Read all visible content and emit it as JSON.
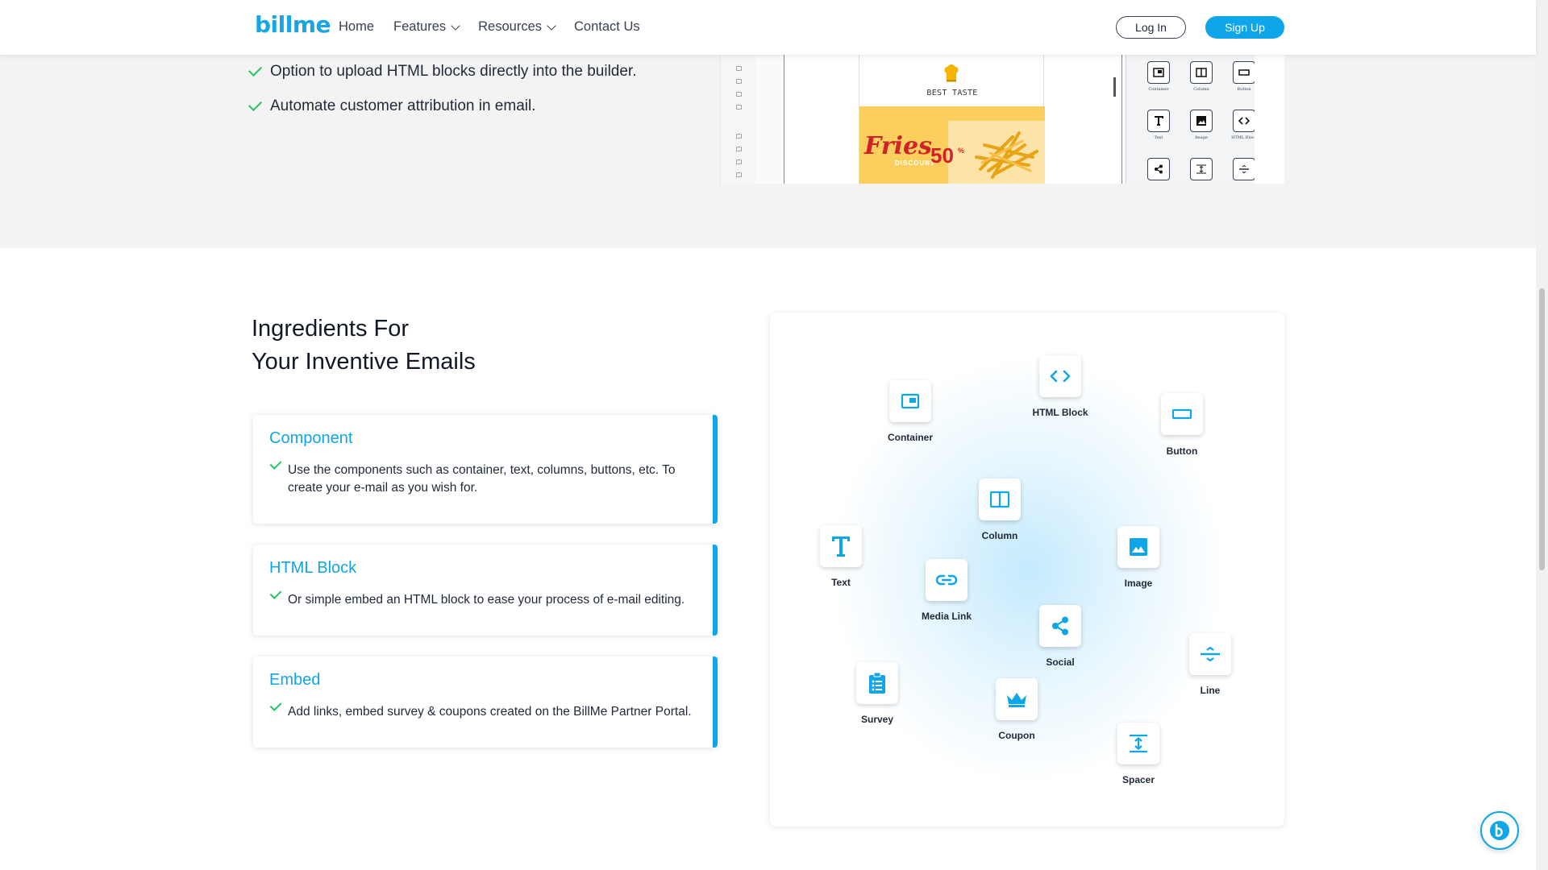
{
  "nav": {
    "logo": "billme",
    "links": [
      "Home",
      "Features",
      "Resources",
      "Contact Us"
    ],
    "login": "Log In",
    "signup": "Sign Up"
  },
  "top_features": [
    "Option to upload HTML blocks directly into the builder.",
    "Automate customer attribution in email."
  ],
  "builder_preview": {
    "tagline": "BEST TASTE",
    "banner_word": "Fries",
    "banner_sub": "DISCOUNT",
    "banner_value": "50",
    "banner_pct": "%",
    "panel_items": [
      "Container",
      "Column",
      "Button",
      "Text",
      "Image",
      "HTML Block"
    ]
  },
  "ingredients": {
    "heading_line1": "Ingredients For",
    "heading_line2": "Your Inventive Emails",
    "cards": [
      {
        "title": "Component",
        "text": "Use the components such as container, text, columns, buttons, etc. To create your e-mail as you wish for."
      },
      {
        "title": "HTML Block",
        "text": "Or simple embed an HTML block to ease your process of e-mail editing."
      },
      {
        "title": "Embed",
        "text": "Add links, embed survey & coupons created on the BillMe Partner Portal."
      }
    ]
  },
  "diagram_nodes": [
    {
      "name": "container",
      "label": "Container",
      "icon": "container-icon"
    },
    {
      "name": "html-block",
      "label": "HTML Block",
      "icon": "code-icon"
    },
    {
      "name": "button",
      "label": "Button",
      "icon": "button-icon"
    },
    {
      "name": "column",
      "label": "Column",
      "icon": "column-icon"
    },
    {
      "name": "text",
      "label": "Text",
      "icon": "text-icon"
    },
    {
      "name": "image",
      "label": "Image",
      "icon": "image-icon"
    },
    {
      "name": "media-link",
      "label": "Media Link",
      "icon": "link-icon"
    },
    {
      "name": "social",
      "label": "Social",
      "icon": "share-icon"
    },
    {
      "name": "line",
      "label": "Line",
      "icon": "divider-icon"
    },
    {
      "name": "survey",
      "label": "Survey",
      "icon": "clipboard-icon"
    },
    {
      "name": "coupon",
      "label": "Coupon",
      "icon": "crown-icon"
    },
    {
      "name": "spacer",
      "label": "Spacer",
      "icon": "spacer-icon"
    }
  ],
  "colors": {
    "accent": "#0ea5e9",
    "check": "#22c55e"
  }
}
